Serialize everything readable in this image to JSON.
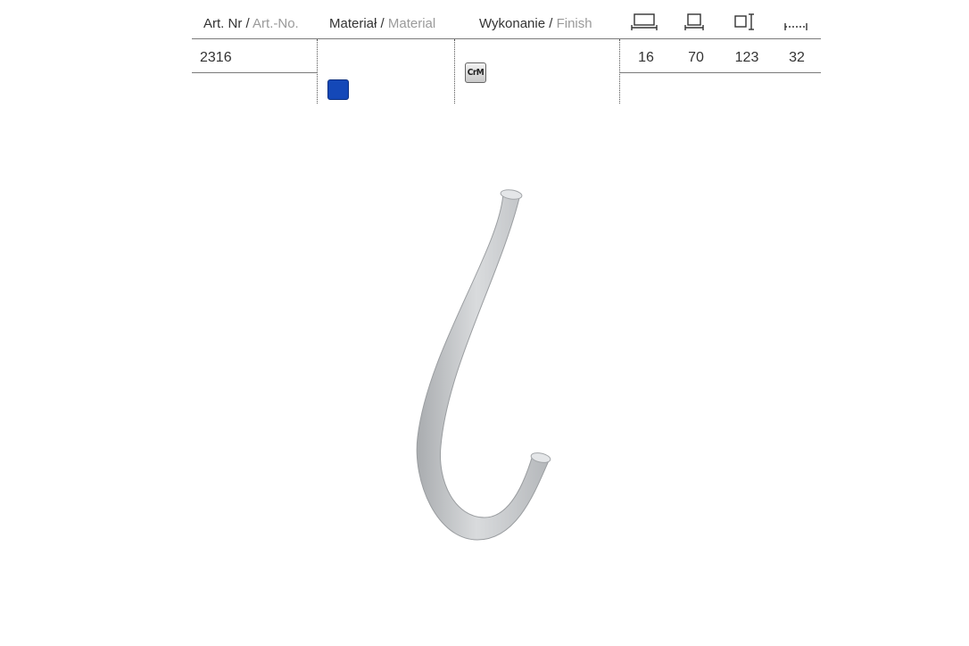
{
  "header": {
    "article": {
      "primary": "Art. Nr",
      "secondary": "Art.-No."
    },
    "material": {
      "primary": "Materiał",
      "secondary": "Material"
    },
    "finish": {
      "primary": "Wykonanie",
      "secondary": "Finish"
    },
    "separator": " / ",
    "dimension_icons": [
      "width-icon",
      "depth-icon",
      "height-icon",
      "hole-spacing-icon"
    ]
  },
  "row": {
    "article_number": "2316",
    "material_color": "#1448b8",
    "finish_code": "CrM",
    "dimensions": [
      "16",
      "70",
      "123",
      "32"
    ]
  },
  "product": {
    "icon": "curved-hook-handle",
    "color": "#c8cacc"
  }
}
